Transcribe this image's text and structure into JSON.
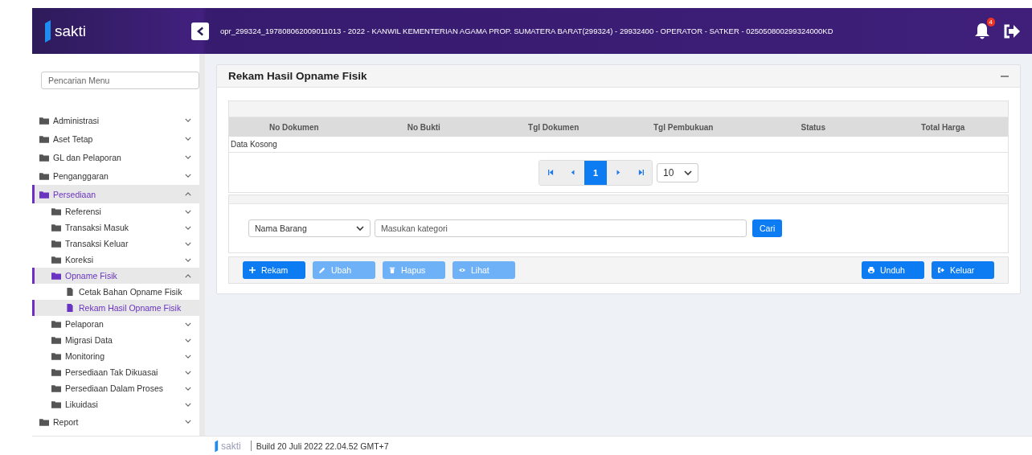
{
  "header": {
    "logo_text": "sakti",
    "info": "opr_299324_197808062009011013 - 2022 - KANWIL KEMENTERIAN AGAMA PROP. SUMATERA BARAT(299324) - 29932400 - OPERATOR - SATKER - 025050800299324000KD",
    "notification_count": "4"
  },
  "sidebar": {
    "search": {
      "placeholder": "Pencarian Menu"
    },
    "items": [
      {
        "label": "Administrasi",
        "kind": "folder",
        "expanded": false
      },
      {
        "label": "Aset Tetap",
        "kind": "folder",
        "expanded": false
      },
      {
        "label": "GL dan Pelaporan",
        "kind": "folder",
        "expanded": false
      },
      {
        "label": "Penganggaran",
        "kind": "folder",
        "expanded": false
      },
      {
        "label": "Persediaan",
        "kind": "folder",
        "expanded": true,
        "children": [
          {
            "label": "Referensi",
            "kind": "folder",
            "expanded": false
          },
          {
            "label": "Transaksi Masuk",
            "kind": "folder",
            "expanded": false
          },
          {
            "label": "Transaksi Keluar",
            "kind": "folder",
            "expanded": false
          },
          {
            "label": "Koreksi",
            "kind": "folder",
            "expanded": false
          },
          {
            "label": "Opname Fisik",
            "kind": "folder",
            "expanded": true,
            "children": [
              {
                "label": "Cetak Bahan Opname Fisik",
                "kind": "page",
                "selected": false
              },
              {
                "label": "Rekam Hasil Opname Fisik",
                "kind": "page",
                "selected": true
              }
            ]
          },
          {
            "label": "Pelaporan",
            "kind": "folder",
            "expanded": false
          },
          {
            "label": "Migrasi Data",
            "kind": "folder",
            "expanded": false
          },
          {
            "label": "Monitoring",
            "kind": "folder",
            "expanded": false
          },
          {
            "label": "Persediaan Tak Dikuasai",
            "kind": "folder",
            "expanded": false
          },
          {
            "label": "Persediaan Dalam Proses",
            "kind": "folder",
            "expanded": false
          },
          {
            "label": "Likuidasi",
            "kind": "folder",
            "expanded": false
          }
        ]
      },
      {
        "label": "Report",
        "kind": "folder",
        "expanded": false
      }
    ]
  },
  "panel": {
    "title": "Rekam Hasil Opname Fisik",
    "table": {
      "columns": [
        "No Dokumen",
        "No Bukti",
        "Tgl Dokumen",
        "Tgl Pembukuan",
        "Status",
        "Total Harga"
      ],
      "empty_text": "Data Kosong"
    },
    "pagination": {
      "pages": [
        {
          "label": "1",
          "selected": true
        }
      ],
      "page_size": "10"
    },
    "filter": {
      "field": "Nama Barang",
      "placeholder": "Masukan kategori",
      "button": "Cari"
    },
    "actions_left": [
      {
        "label": "Rekam",
        "kind": "plus",
        "disabled": false
      },
      {
        "label": "Ubah",
        "kind": "pencil",
        "disabled": true
      },
      {
        "label": "Hapus",
        "kind": "trash",
        "disabled": true
      },
      {
        "label": "Lihat",
        "kind": "eye",
        "disabled": true
      }
    ],
    "actions_right": [
      {
        "label": "Unduh",
        "kind": "print",
        "disabled": false
      },
      {
        "label": "Keluar",
        "kind": "exit",
        "disabled": false
      }
    ]
  },
  "footer": {
    "logo_text": "sakti",
    "build": "Build 20 Juli 2022 22.04.52 GMT+7"
  }
}
